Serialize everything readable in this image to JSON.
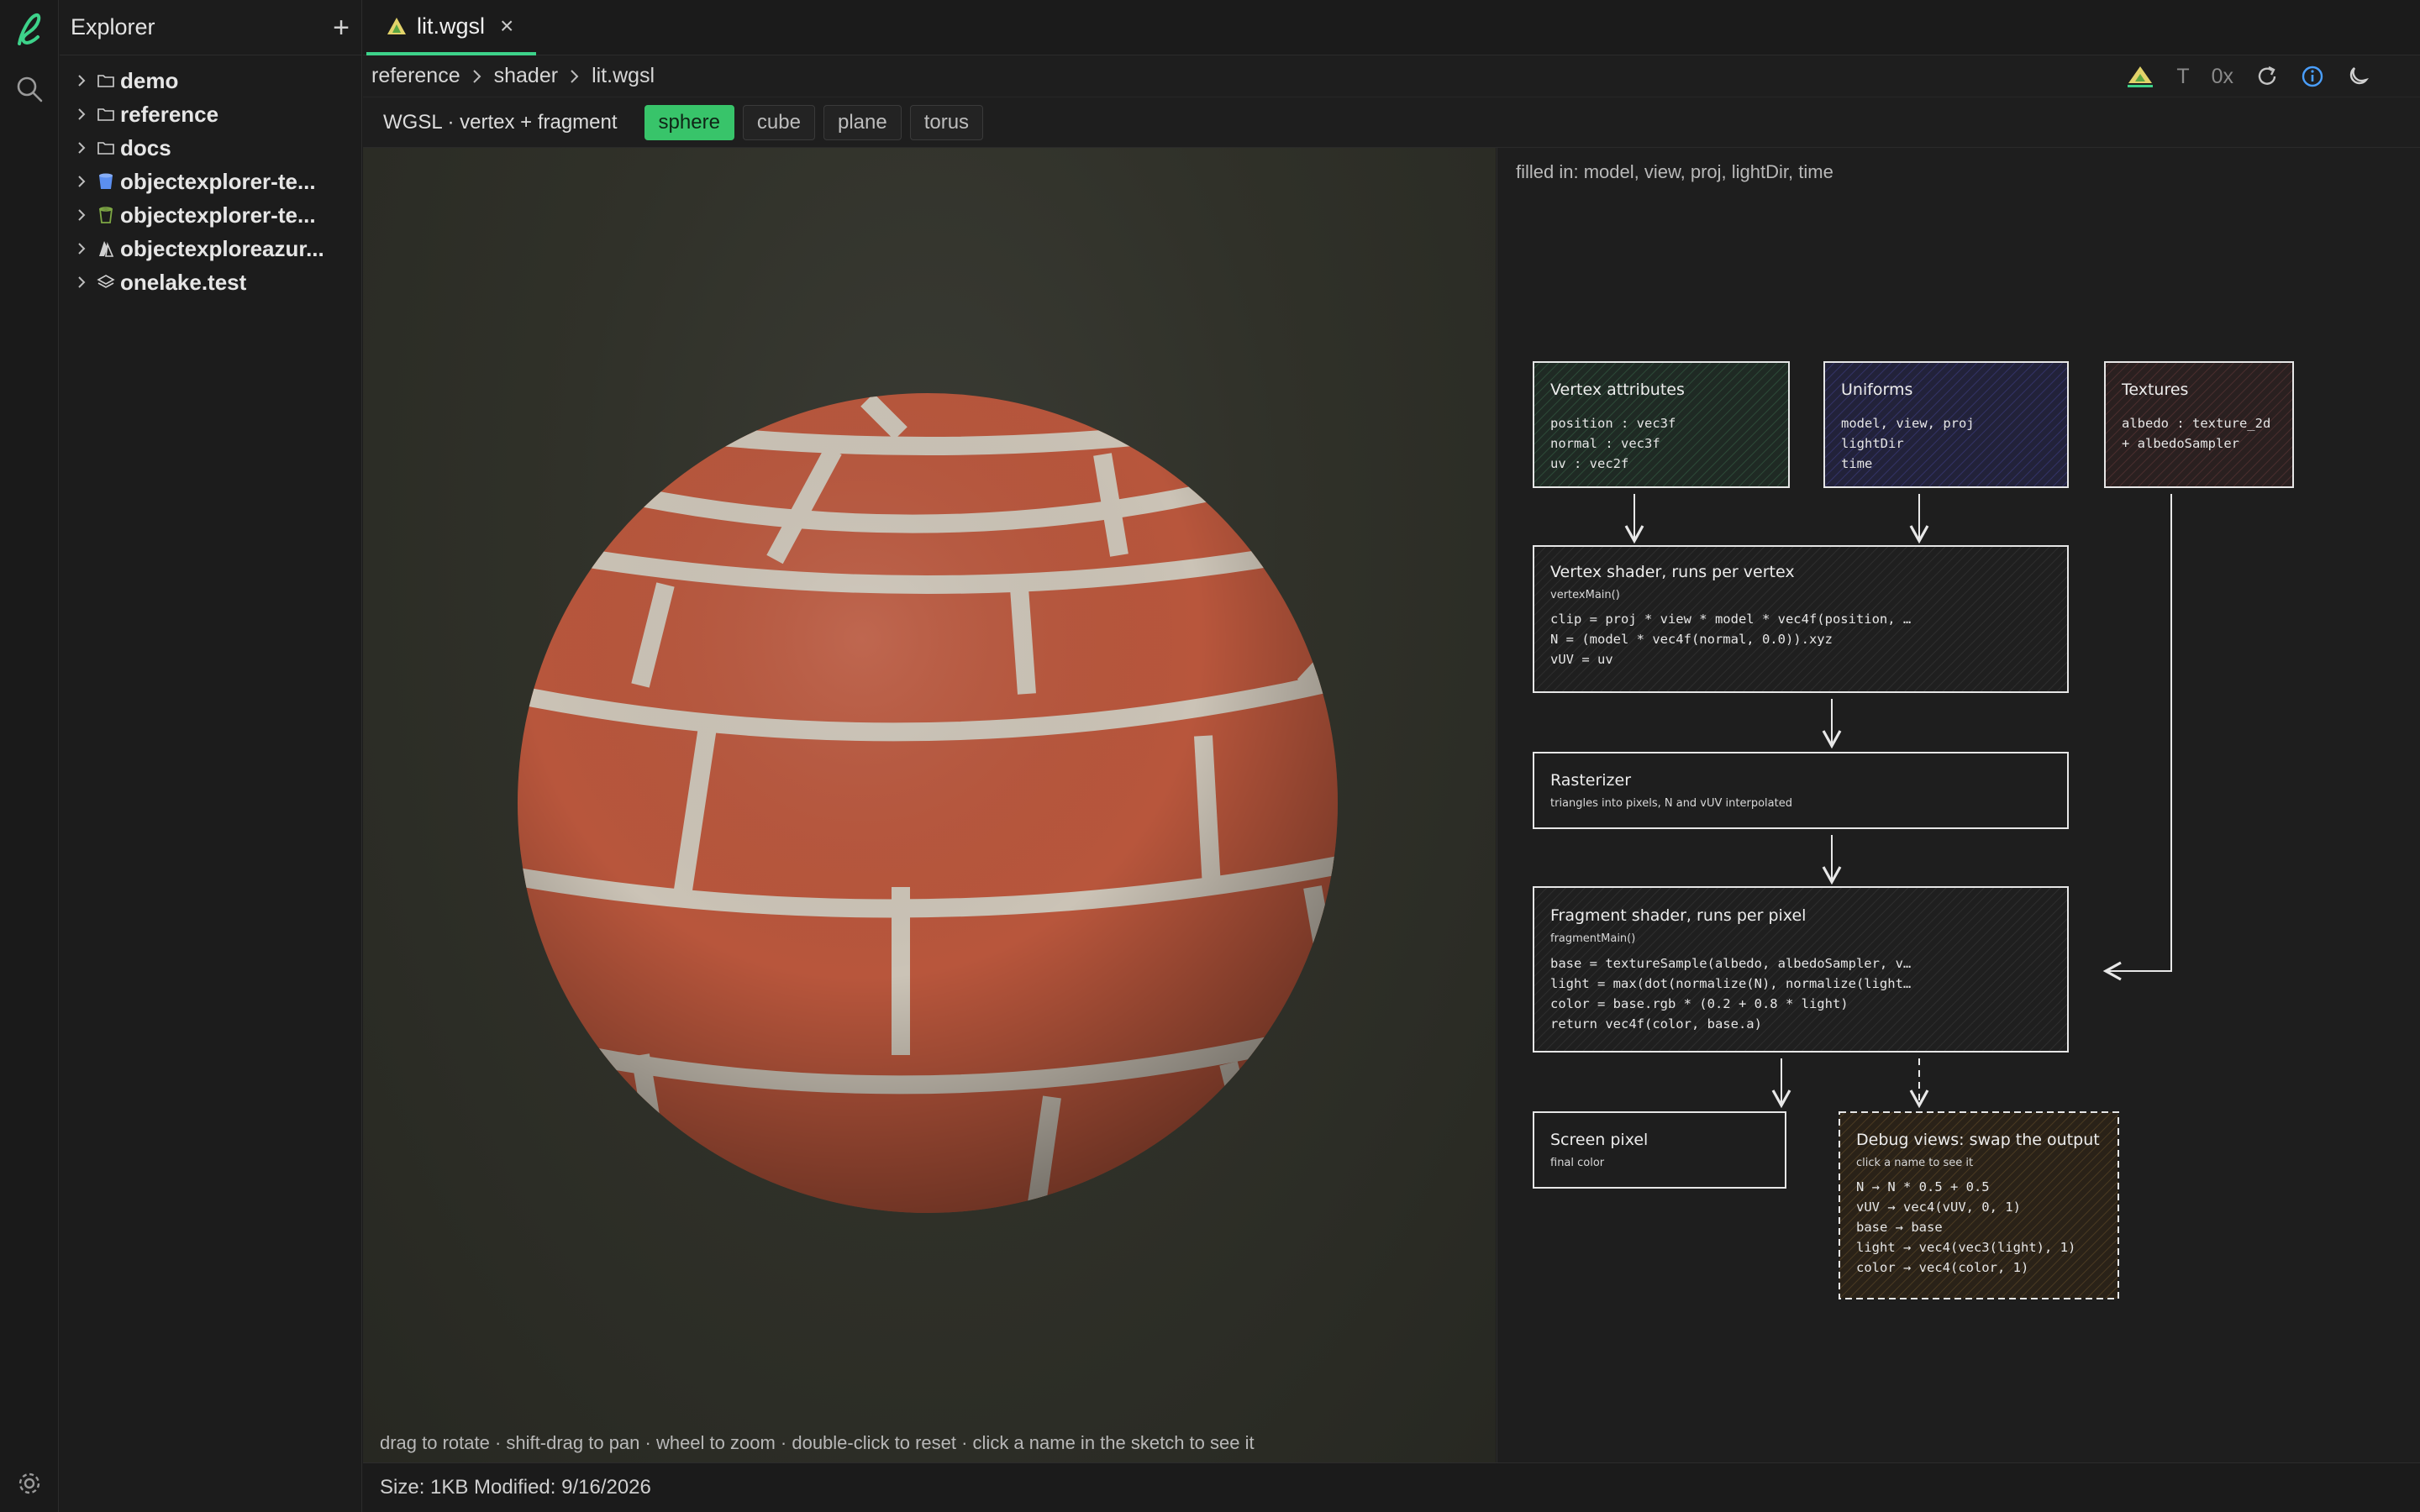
{
  "app": {
    "sidebar_title": "Explorer",
    "add_label": "+"
  },
  "tree": [
    {
      "name": "demo",
      "icon": "folder-icon"
    },
    {
      "name": "reference",
      "icon": "folder-icon"
    },
    {
      "name": "docs",
      "icon": "folder-icon"
    },
    {
      "name": "objectexplorer-te...",
      "icon": "blue-bucket-icon"
    },
    {
      "name": "objectexplorer-te...",
      "icon": "green-bucket-icon"
    },
    {
      "name": "objectexploreazur...",
      "icon": "azure-icon"
    },
    {
      "name": "onelake.test",
      "icon": "layers-icon"
    }
  ],
  "tab": {
    "label": "lit.wgsl",
    "close": "×"
  },
  "breadcrumb": [
    "reference",
    "shader",
    "lit.wgsl"
  ],
  "toolbar": {
    "t_label": "T",
    "hex_label": "0x"
  },
  "subheader": {
    "title": "WGSL · vertex + fragment",
    "shapes": [
      "sphere",
      "cube",
      "plane",
      "torus"
    ],
    "active_shape": "sphere"
  },
  "viewport": {
    "hint": "drag to rotate · shift-drag to pan · wheel to zoom · double-click to reset · click a name in the sketch to see it"
  },
  "diagram": {
    "filled": "filled in: model, view, proj, lightDir, time",
    "vertex_attributes": {
      "title": "Vertex attributes",
      "lines": [
        "position : vec3f",
        "normal : vec3f",
        "uv : vec2f"
      ]
    },
    "uniforms": {
      "title": "Uniforms",
      "lines": [
        "model, view, proj",
        "lightDir",
        "time"
      ]
    },
    "textures": {
      "title": "Textures",
      "lines": [
        "albedo : texture_2d",
        "+ albedoSampler"
      ]
    },
    "vertex_shader": {
      "title": "Vertex shader, runs per vertex",
      "fn": "vertexMain()",
      "lines": [
        "clip = proj * view * model * vec4f(position, …",
        "N = (model * vec4f(normal, 0.0)).xyz",
        "vUV = uv"
      ]
    },
    "rasterizer": {
      "title": "Rasterizer",
      "sub": "triangles into pixels, N and vUV interpolated"
    },
    "fragment_shader": {
      "title": "Fragment shader, runs per pixel",
      "fn": "fragmentMain()",
      "lines": [
        "base = textureSample(albedo, albedoSampler, v…",
        "light = max(dot(normalize(N), normalize(light…",
        "color = base.rgb * (0.2 + 0.8 * light)",
        "return vec4f(color, base.a)"
      ]
    },
    "screen_pixel": {
      "title": "Screen pixel",
      "sub": "final color"
    },
    "debug_views": {
      "title": "Debug views: swap the output",
      "sub": "click a name to see it",
      "lines": [
        "N → N * 0.5 + 0.5",
        "vUV → vec4(vUV, 0, 1)",
        "base → base",
        "light → vec4(vec3(light), 1)",
        "color → vec4(color, 1)"
      ]
    }
  },
  "status": {
    "text": "Size: 1KB Modified: 9/16/2026"
  },
  "colors": {
    "accent": "#3dd28a",
    "brick": "#b8563c",
    "mortar": "#c9c1b4"
  }
}
